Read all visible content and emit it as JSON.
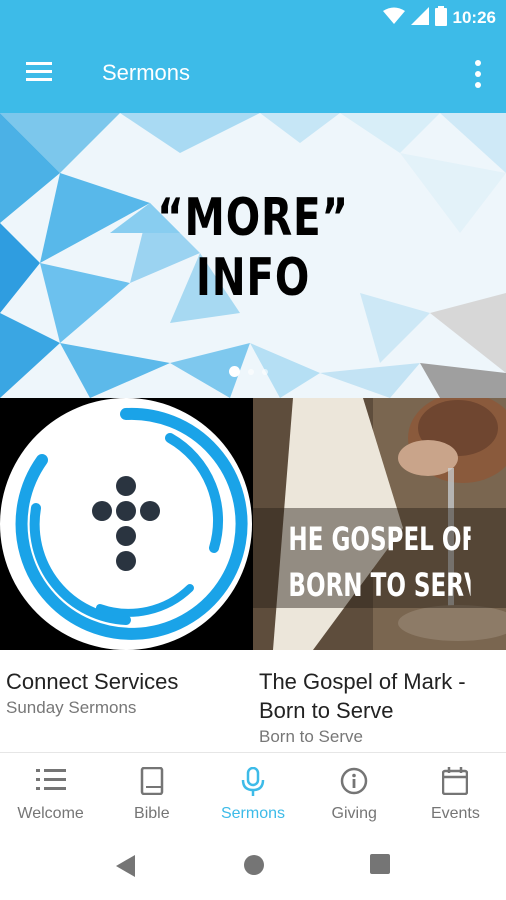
{
  "status_bar": {
    "time": "10:26"
  },
  "app_bar": {
    "title": "Sermons"
  },
  "banner": {
    "line1": "“MORE”",
    "line2": "INFO",
    "slides": 3,
    "active_slide": 1
  },
  "cards": [
    {
      "title": "Connect Services",
      "subtitle": "Sunday Sermons",
      "image": "connect-cross-logo"
    },
    {
      "title": "The Gospel of Mark - Born to Serve",
      "subtitle": "Born to Serve",
      "image_text_line1": "HE GOSPEL OF MAR",
      "image_text_line2": "BORN TO SERVE"
    }
  ],
  "bottom_nav": [
    {
      "label": "Welcome",
      "icon": "list-icon",
      "active": false
    },
    {
      "label": "Bible",
      "icon": "book-icon",
      "active": false
    },
    {
      "label": "Sermons",
      "icon": "microphone-icon",
      "active": true
    },
    {
      "label": "Giving",
      "icon": "info-icon",
      "active": false
    },
    {
      "label": "Events",
      "icon": "calendar-icon",
      "active": false
    }
  ],
  "colors": {
    "accent": "#3dbbe8",
    "inactive": "#757575",
    "logo_ring": "#1aa3e8",
    "logo_dots": "#2a3440"
  }
}
